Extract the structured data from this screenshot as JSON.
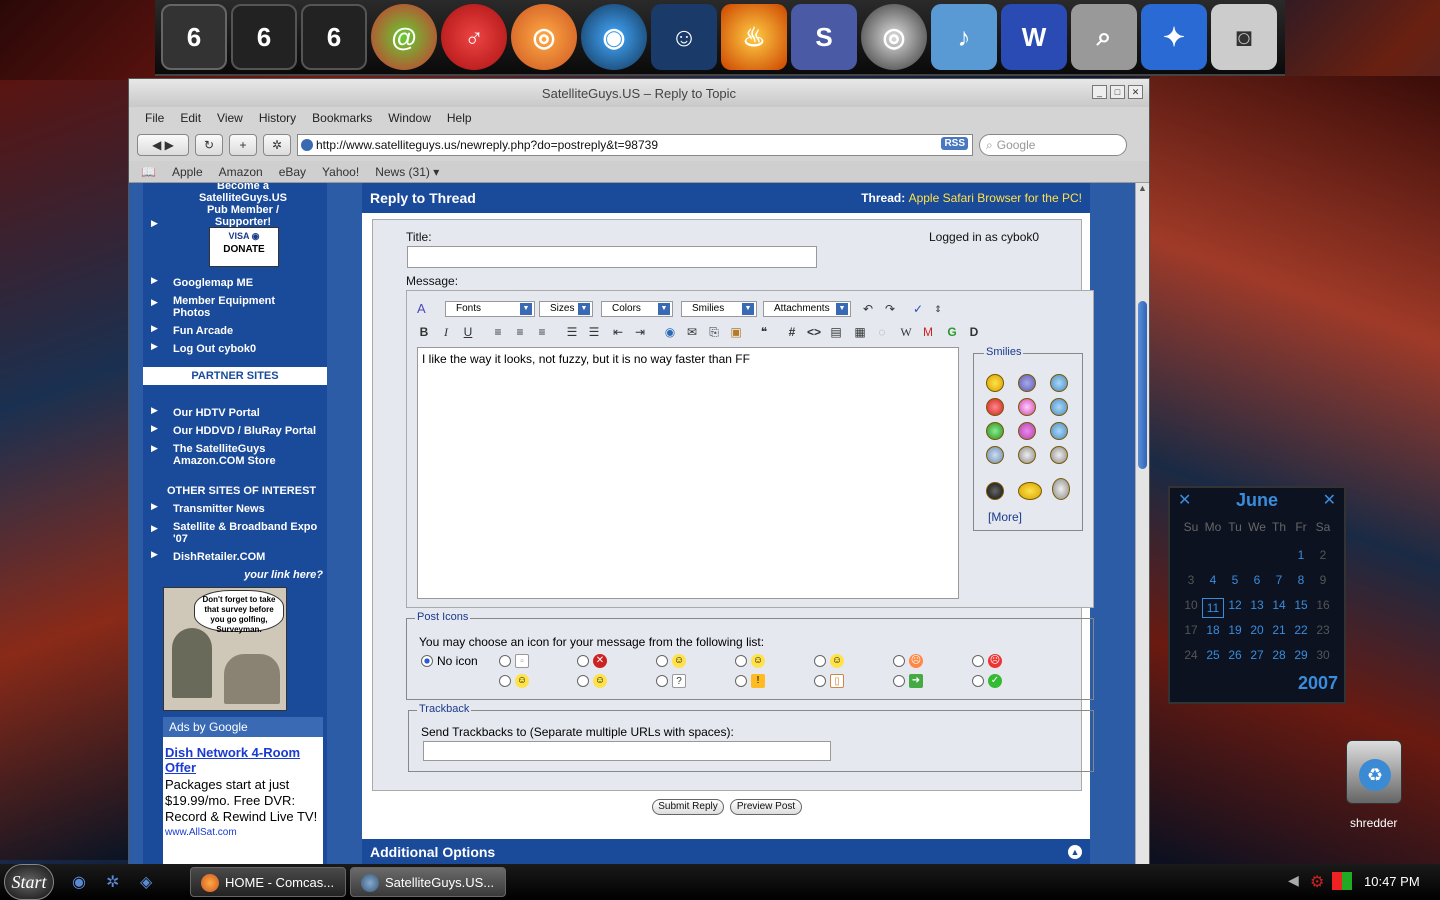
{
  "browser": {
    "title": "SatelliteGuys.US – Reply to Topic",
    "menus": [
      "File",
      "Edit",
      "View",
      "History",
      "Bookmarks",
      "Window",
      "Help"
    ],
    "url": "http://www.satelliteguys.us/newreply.php?do=postreply&t=98739",
    "rss": "RSS",
    "search_placeholder": "Google",
    "bookmarks": [
      "Apple",
      "Amazon",
      "eBay",
      "Yahoo!",
      "News (31) ▾"
    ]
  },
  "sidebar": {
    "become": "Become a SatelliteGuys.US Pub Member / Supporter!",
    "donate": "DONATE",
    "links1": [
      "Googlemap ME",
      "Member Equipment Photos",
      "Fun Arcade",
      "Log Out cybok0"
    ],
    "partner_header": "PARTNER SITES",
    "links2": [
      "Our HDTV Portal",
      "Our HDDVD / BluRay Portal",
      "The SatelliteGuys Amazon.COM Store"
    ],
    "other_header": "OTHER SITES OF INTEREST",
    "links3": [
      "Transmitter News",
      "Satellite & Broadband Expo '07",
      "DishRetailer.COM"
    ],
    "your_link": "your link here?",
    "ad_image_text": "Don't forget to take that survey before you go golfing, Surveyman.",
    "ads_by": "Ads by Google",
    "ad_title": "Dish Network 4-Room Offer",
    "ad_body": "Packages start at just $19.99/mo. Free DVR: Record & Rewind Live TV!",
    "ad_url": "www.AllSat.com"
  },
  "thread": {
    "header": "Reply to Thread",
    "thread_label": "Thread:",
    "thread_title": "Apple Safari Browser for the PC!",
    "title_label": "Title:",
    "logged_in": "Logged in as cybok0",
    "message_label": "Message:",
    "editor_dropdowns": [
      "Fonts",
      "Sizes",
      "Colors",
      "Smilies",
      "Attachments"
    ],
    "message_text": "I like the way it looks, not fuzzy, but it is no way faster than FF",
    "smilies_label": "Smilies",
    "more": "[More]",
    "post_icons_label": "Post Icons",
    "post_icons_hint": "You may choose an icon for your message from the following list:",
    "no_icon": "No icon",
    "trackback_label": "Trackback",
    "trackback_hint": "Send Trackbacks to (Separate multiple URLs with spaces):",
    "submit": "Submit Reply",
    "preview": "Preview Post",
    "additional": "Additional Options"
  },
  "calendar": {
    "month": "June",
    "year": "2007",
    "weekdays": [
      "Su",
      "Mo",
      "Tu",
      "We",
      "Th",
      "Fr",
      "Sa"
    ],
    "rows": [
      [
        "",
        "",
        "",
        "",
        "",
        "1",
        "2"
      ],
      [
        "3",
        "4",
        "5",
        "6",
        "7",
        "8",
        "9"
      ],
      [
        "10",
        "11",
        "12",
        "13",
        "14",
        "15",
        "16"
      ],
      [
        "17",
        "18",
        "19",
        "20",
        "21",
        "22",
        "23"
      ],
      [
        "24",
        "25",
        "26",
        "27",
        "28",
        "29",
        "30"
      ]
    ],
    "today": "11"
  },
  "desktop": {
    "shredder": "shredder"
  },
  "taskbar": {
    "start": "Start",
    "tasks": [
      "HOME - Comcas...",
      "SatelliteGuys.US..."
    ],
    "clock": "10:47 PM"
  },
  "colors": {
    "site_blue": "#1a4a9a",
    "link_blue": "#1a3ad0",
    "thread_yellow": "#ffe24a"
  }
}
